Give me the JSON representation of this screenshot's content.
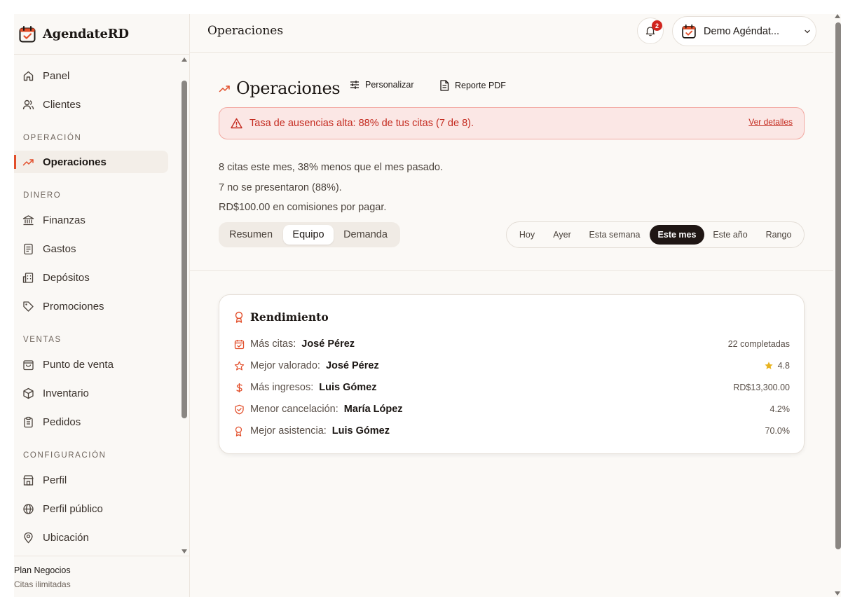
{
  "brand": {
    "name": "AgendateRD"
  },
  "sidebar": {
    "items_top": [
      {
        "label": "Panel",
        "icon": "home-icon"
      },
      {
        "label": "Clientes",
        "icon": "users-icon"
      }
    ],
    "sections": [
      {
        "label": "OPERACIÓN",
        "items": [
          {
            "label": "Operaciones",
            "icon": "trending-up-icon",
            "active": true
          }
        ]
      },
      {
        "label": "DINERO",
        "items": [
          {
            "label": "Finanzas",
            "icon": "bank-icon"
          },
          {
            "label": "Gastos",
            "icon": "receipt-icon"
          },
          {
            "label": "Depósitos",
            "icon": "building-icon"
          },
          {
            "label": "Promociones",
            "icon": "tag-icon"
          }
        ]
      },
      {
        "label": "VENTAS",
        "items": [
          {
            "label": "Punto de venta",
            "icon": "shopping-bag-icon"
          },
          {
            "label": "Inventario",
            "icon": "package-icon"
          },
          {
            "label": "Pedidos",
            "icon": "clipboard-icon"
          }
        ]
      },
      {
        "label": "CONFIGURACIÓN",
        "items": [
          {
            "label": "Perfil",
            "icon": "store-icon"
          },
          {
            "label": "Perfil público",
            "icon": "globe-icon"
          },
          {
            "label": "Ubicación",
            "icon": "map-pin-icon"
          }
        ]
      }
    ],
    "plan": {
      "name": "Plan Negocios",
      "sub": "Citas ilimitadas"
    }
  },
  "header": {
    "title": "Operaciones",
    "notifications_count": "2",
    "account_name": "Demo Agéndat..."
  },
  "page": {
    "title": "Operaciones",
    "customize_label": "Personalizar",
    "report_label": "Reporte PDF",
    "alert": {
      "text": "Tasa de ausencias alta: 88% de tus citas (7 de 8).",
      "link": "Ver detalles"
    },
    "summary": [
      "8 citas este mes, 38% menos que el mes pasado.",
      "7 no se presentaron (88%).",
      "RD$100.00 en comisiones por pagar."
    ],
    "tabs": [
      "Resumen",
      "Equipo",
      "Demanda"
    ],
    "active_tab": "Equipo",
    "periods": [
      "Hoy",
      "Ayer",
      "Esta semana",
      "Este mes",
      "Este año",
      "Rango"
    ],
    "active_period": "Este mes"
  },
  "performance": {
    "title": "Rendimiento",
    "rows": [
      {
        "icon": "calendar-check-icon",
        "label": "Más citas:",
        "name": "José Pérez",
        "value": "22 completadas"
      },
      {
        "icon": "star-outline-icon",
        "label": "Mejor valorado:",
        "name": "José Pérez",
        "value": "4.8"
      },
      {
        "icon": "dollar-icon",
        "label": "Más ingresos:",
        "name": "Luis Gómez",
        "value": "RD$13,300.00"
      },
      {
        "icon": "shield-check-icon",
        "label": "Menor cancelación:",
        "name": "María López",
        "value": "4.2%"
      },
      {
        "icon": "award-icon",
        "label": "Mejor asistencia:",
        "name": "Luis Gómez",
        "value": "70.0%"
      }
    ]
  },
  "colors": {
    "accent": "#e24e2a",
    "alert_bg": "#fbe7e5",
    "alert_text": "#c42a1f",
    "dark_pill": "#1f1614",
    "badge": "#d1251f",
    "star": "#e8b320"
  }
}
